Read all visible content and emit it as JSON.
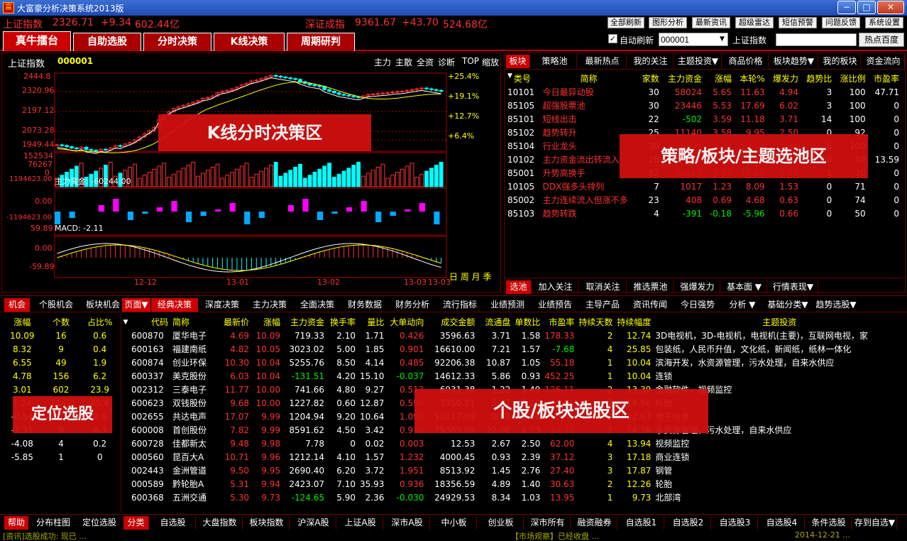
{
  "window": {
    "title": "大富豪分析决策系统2013版",
    "icon": "app-logo",
    "min": "−",
    "max": "□",
    "close": "✕"
  },
  "indexbar": {
    "sh_name": "上证指数",
    "sh_value": "2326.71",
    "sh_change": "+9.34",
    "sh_amount": "602.44亿",
    "sz_name": "深证成指",
    "sz_value": "9361.67",
    "sz_change": "+43.70",
    "sz_amount": "524.68亿"
  },
  "toolbar": [
    "全部刷新",
    "图形分析",
    "最新资讯",
    "超级雷达",
    "短信预警",
    "问题反馈",
    "系统设置"
  ],
  "main_tabs": [
    "真牛擂台",
    "自助选股",
    "分时决策",
    "K线决策",
    "周期研判"
  ],
  "controls": {
    "auto_refresh_label": "自动刷新",
    "code_value": "000001",
    "index_label": "上证指数",
    "hot_button": "热点百度"
  },
  "chart": {
    "title": "上证指数",
    "code": "000001",
    "header_links": [
      "主力",
      "主散",
      "全资",
      "诊断",
      "TOP",
      "缩放"
    ],
    "price_ticks": [
      "2444.8",
      "2320.96",
      "2197.12",
      "2073.28",
      "1949.44"
    ],
    "pct_ticks": [
      "+25.4%",
      "+19.1%",
      "+12.7%",
      "+6.4%"
    ],
    "vol_ticks": [
      "152534",
      "76267",
      "0"
    ],
    "fund_label": "主力资金: -60244.00",
    "fund_ticks": [
      "1194623.00",
      "0.00",
      "-1194623.00"
    ],
    "macd_label": "MACD: -2.11",
    "macd_ticks": [
      "59.89",
      "0.00",
      "-59.89"
    ],
    "date_ticks": [
      "12-12",
      "13-01",
      "13-02",
      "13-03",
      "13-03"
    ],
    "period_links": "日 周 月 季",
    "overlay": "K线分时决策区"
  },
  "chart_data": {
    "type": "candlestick",
    "ylim": [
      1949.44,
      2444.8
    ],
    "closes": [
      1990,
      1985,
      1978,
      1970,
      1965,
      1975,
      1960,
      1955,
      1950,
      1962,
      1958,
      1970,
      1985,
      1980,
      1995,
      2005,
      2020,
      2040,
      2060,
      2080,
      2100,
      2150,
      2180,
      2200,
      2220,
      2230,
      2240,
      2250,
      2260,
      2270,
      2285,
      2290,
      2300,
      2320,
      2330,
      2335,
      2345,
      2355,
      2370,
      2380,
      2395,
      2400,
      2410,
      2420,
      2430,
      2425,
      2420,
      2415,
      2410,
      2405,
      2390,
      2380,
      2370,
      2365,
      2360,
      2340,
      2330,
      2320,
      2310,
      2305,
      2300,
      2295,
      2290,
      2300,
      2310,
      2312,
      2315,
      2318,
      2320,
      2325,
      2328,
      2330,
      2335,
      2340,
      2345,
      2350,
      2345,
      2340,
      2335,
      2330
    ]
  },
  "right_panel": {
    "tabs": [
      "板块",
      "策略池",
      "最新热点",
      "我的关注",
      "主题投资▼",
      "商品价格",
      "板块趋势▼",
      "我的板块",
      "资金流向"
    ],
    "columns": [
      "类号",
      "简称",
      "家数",
      "主力资金",
      "涨幅",
      "本轮%",
      "爆发力",
      "趋势比",
      "涨比例",
      "市盈率"
    ],
    "rows": [
      [
        "10101",
        "今日最异动股",
        "30",
        "58024",
        "5.65",
        "11.63",
        "4.94",
        "3",
        "100",
        "47.71"
      ],
      [
        "85105",
        "超强股票池",
        "30",
        "23446",
        "5.53",
        "17.69",
        "6.02",
        "3",
        "100",
        "0"
      ],
      [
        "85101",
        "短线出击",
        "22",
        "-502",
        "3.59",
        "11.18",
        "3.71",
        "14",
        "100",
        "0"
      ],
      [
        "85102",
        "趋势转升",
        "25",
        "11140",
        "3.58",
        "9.95",
        "2.50",
        "0",
        "92",
        "0"
      ],
      [
        "85104",
        "行业龙头",
        "30",
        "8959",
        "3.29",
        "10.23",
        "1.69",
        "0",
        "100",
        "0"
      ],
      [
        "10102",
        "主力资金流出转流入",
        "28",
        "7530",
        "3.25",
        "3.47",
        "1.71",
        "0",
        "89",
        "13.59"
      ],
      [
        "85001",
        "升势高换手",
        "82",
        "20412",
        "1.67",
        "10.41",
        "1.57",
        "1",
        "70",
        "0"
      ],
      [
        "10105",
        "DDX强多头排列",
        "7",
        "1017",
        "1.23",
        "8.09",
        "1.53",
        "0",
        "71",
        "0"
      ],
      [
        "85002",
        "主力连续流入但涨不多",
        "23",
        "408",
        "0.69",
        "4.68",
        "0.63",
        "0",
        "74",
        "0"
      ],
      [
        "85103",
        "趋势转跌",
        "4",
        "-391",
        "-0.18",
        "-5.96",
        "0.66",
        "0",
        "50",
        "0"
      ]
    ],
    "bottom_tabs": [
      "选池",
      "加入关注",
      "取消关注",
      "推选票池",
      "强爆发力",
      "基本面 ▼",
      "行情表现▼"
    ],
    "overlay": "策略/板块/主题选池区"
  },
  "left_panel": {
    "tabs": [
      "机会",
      "个股机会",
      "板块机会"
    ],
    "columns": [
      "涨幅",
      "个数",
      "占比%"
    ],
    "rows": [
      [
        "10.09",
        "16",
        "0.6"
      ],
      [
        "8.32",
        "9",
        "0.4"
      ],
      [
        "6.55",
        "49",
        "1.9"
      ],
      [
        "4.78",
        "156",
        "6.2"
      ],
      [
        "3.01",
        "602",
        "23.9"
      ],
      [
        "1.24",
        "1142",
        "45.4"
      ],
      [
        "-0.54",
        "217",
        "8.6"
      ],
      [
        "-2.31",
        "8",
        "0.3"
      ],
      [
        "-4.08",
        "4",
        "0.2"
      ],
      [
        "-5.85",
        "1",
        "0"
      ]
    ],
    "overlay": "定位选股"
  },
  "stock_panel": {
    "tabs": [
      "页面▼",
      "经典决策",
      "深度决策",
      "主力决策",
      "全面决策",
      "财务数据",
      "财务分析",
      "流行指标",
      "业绩预测",
      "业绩预告",
      "主导产品",
      "资讯传闻",
      "今日强势",
      "分析 ▼",
      "基础分类▼",
      "趋势选股▼"
    ],
    "columns": [
      "代码",
      "简称",
      "最新价",
      "涨幅",
      "主力资金",
      "换手率",
      "量比",
      "大单动向",
      "成交金额",
      "流通盘",
      "单数比",
      "市盈率",
      "持续天数",
      "持续幅度",
      "主题投资"
    ],
    "rows": [
      [
        "600870",
        "厦华电子",
        "4.69",
        "10.09",
        "719.33",
        "2.10",
        "1.71",
        "0.426",
        "3596.63",
        "3.71",
        "1.58",
        "178.33",
        "2",
        "12.74",
        "3D电视机，3D-电视机，电视机(主要)，互联网电视，家"
      ],
      [
        "600163",
        "福建南纸",
        "4.82",
        "10.05",
        "3023.02",
        "5.00",
        "1.85",
        "0.901",
        "16610.00",
        "7.21",
        "1.57",
        "-7.68",
        "4",
        "25.85",
        "包装纸，人民币升值，文化纸，新闻纸，纸林一体化"
      ],
      [
        "600874",
        "创业环保",
        "10.30",
        "10.04",
        "5255.76",
        "8.50",
        "4.14",
        "0.485",
        "92206.38",
        "10.87",
        "1.05",
        "55.18",
        "1",
        "10.04",
        "滨海开发，水资源管理，污水处理，自来水供应"
      ],
      [
        "600337",
        "美克股份",
        "6.03",
        "10.04",
        "-131.51",
        "4.20",
        "15.10",
        "-0.037",
        "14612.33",
        "5.86",
        "0.93",
        "452.25",
        "1",
        "10.04",
        "连锁"
      ],
      [
        "002312",
        "三泰电子",
        "11.77",
        "10.00",
        "741.66",
        "4.80",
        "9.27",
        "0.513",
        "6931.38",
        "1.22",
        "1.49",
        "126.11",
        "2",
        "13.39",
        "金融软件，视频监控"
      ],
      [
        "600623",
        "双钱股份",
        "9.68",
        "10.00",
        "1227.82",
        "0.60",
        "12.87",
        "0.596",
        "3350.81",
        "5.67",
        "2.26",
        "52.44",
        "2",
        "14.96",
        "轮胎"
      ],
      [
        "002655",
        "共达电声",
        "17.07",
        "9.99",
        "1204.94",
        "9.20",
        "10.64",
        "1.098",
        "10217.09",
        "0.67",
        "2.66",
        "59.90",
        "2",
        "12.67",
        "电子信息"
      ],
      [
        "600008",
        "首创股份",
        "7.82",
        "9.99",
        "8591.62",
        "4.50",
        "3.42",
        "0.916",
        "75365.08",
        "22.00",
        "1.23",
        "53.32",
        "2",
        "14.16",
        "水资源管理，污水处理，自来水供应"
      ],
      [
        "600728",
        "佳都新太",
        "9.48",
        "9.98",
        "7.78",
        "0",
        "0.02",
        "0.003",
        "12.53",
        "2.67",
        "2.50",
        "62.00",
        "4",
        "13.94",
        "视频监控"
      ],
      [
        "000560",
        "昆百大A",
        "10.71",
        "9.96",
        "1212.14",
        "4.10",
        "1.57",
        "1.232",
        "4000.45",
        "0.93",
        "2.39",
        "37.12",
        "3",
        "17.18",
        "商业连锁"
      ],
      [
        "002443",
        "金洲管道",
        "9.50",
        "9.95",
        "2690.40",
        "6.20",
        "3.72",
        "1.951",
        "8513.92",
        "1.45",
        "2.76",
        "27.40",
        "3",
        "17.87",
        "钢管"
      ],
      [
        "000589",
        "黔轮胎A",
        "5.31",
        "9.94",
        "2423.07",
        "7.10",
        "35.93",
        "0.936",
        "18356.59",
        "4.89",
        "1.40",
        "30.63",
        "2",
        "12.26",
        "轮胎"
      ],
      [
        "600368",
        "五洲交通",
        "5.30",
        "9.73",
        "-124.65",
        "5.90",
        "2.36",
        "-0.030",
        "24929.53",
        "8.34",
        "1.03",
        "13.95",
        "1",
        "9.73",
        "北部湾"
      ]
    ],
    "overlay": "个股/板块选股区"
  },
  "bottom_bar": {
    "left": [
      "帮助",
      "分布柱图",
      "定位选股"
    ],
    "tabs": [
      "分类",
      "自选股",
      "大盘指数",
      "板块指数",
      "沪深A股",
      "上证A股",
      "深市A股",
      "中小板",
      "创业板",
      "深市所有",
      "融资融券",
      "自选股1",
      "自选股2",
      "自选股3",
      "自选股4",
      "条件选股",
      "存到自选▼"
    ]
  },
  "status": {
    "left": "[资讯]选股成功: 现已 ...",
    "mid": "【市场观察】已经收盘 ...",
    "right": "2014-12-21 ..."
  }
}
